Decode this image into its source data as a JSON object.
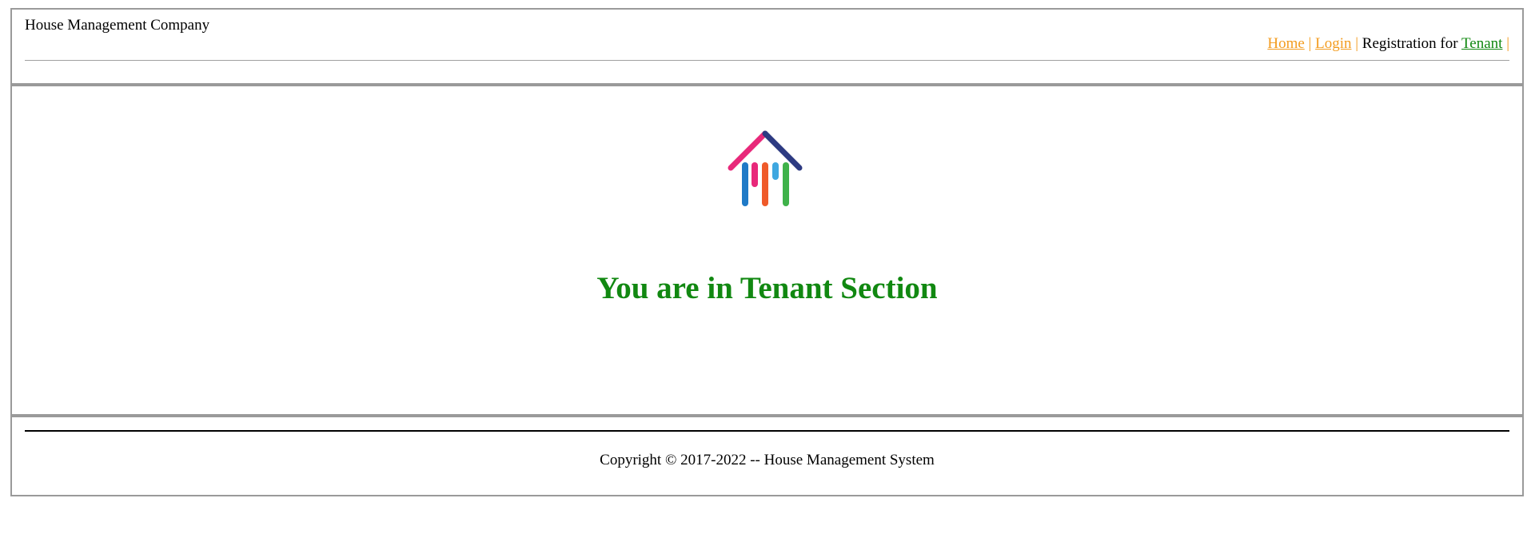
{
  "header": {
    "company_name": "House Management Company",
    "nav": {
      "home_label": "Home",
      "login_label": "Login",
      "registration_text": "Registration for",
      "tenant_label": "Tenant",
      "separator": "|"
    }
  },
  "main": {
    "logo_icon": "house-logo-icon",
    "section_title": "You are in Tenant Section"
  },
  "footer": {
    "copyright": "Copyright © 2017-2022 -- House Management System"
  },
  "colors": {
    "link_orange": "#f39c1f",
    "link_green": "#118811",
    "title_green": "#118811",
    "border_gray": "#9a9a9a"
  }
}
